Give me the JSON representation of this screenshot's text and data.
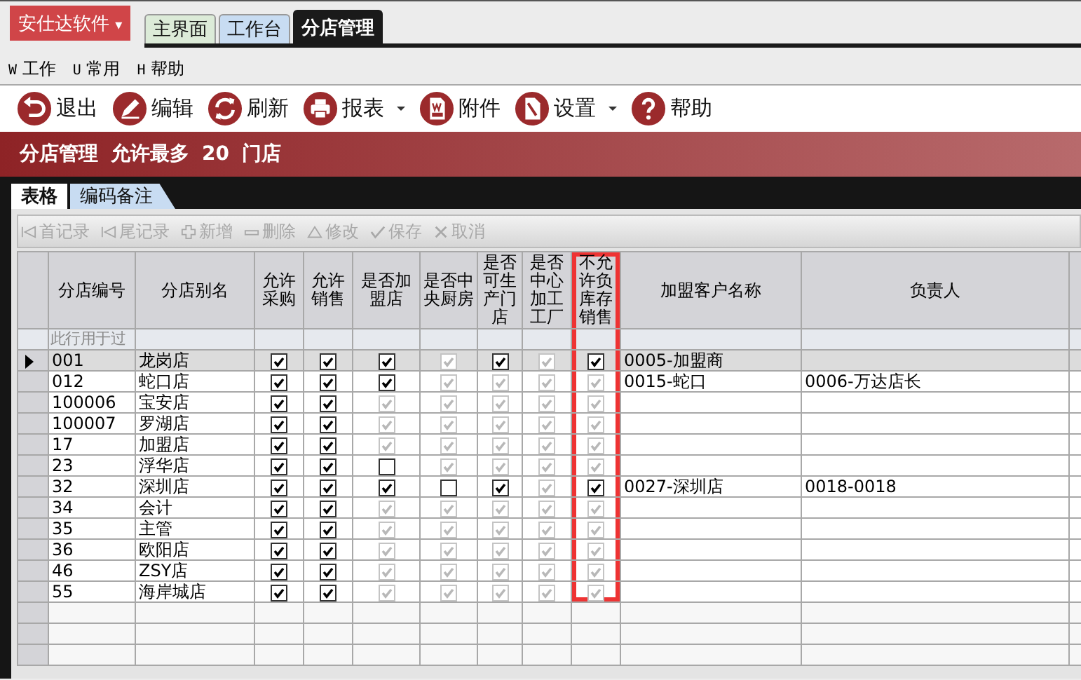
{
  "app_menu": {
    "label": "安仕达软件",
    "caret": "▾"
  },
  "window_tabs": [
    {
      "label": "主界面",
      "selected": false,
      "color": "#dcebd8"
    },
    {
      "label": "工作台",
      "selected": false,
      "color": "#c8dcf2"
    },
    {
      "label": "分店管理",
      "selected": true,
      "color": "#1a1a1a"
    }
  ],
  "menu": [
    {
      "key": "W",
      "label": "工作"
    },
    {
      "key": "U",
      "label": "常用"
    },
    {
      "key": "H",
      "label": "帮助"
    }
  ],
  "toolbar": [
    {
      "label": "退出",
      "kind": "exit",
      "dropdown": false
    },
    {
      "label": "编辑",
      "kind": "edit",
      "dropdown": false
    },
    {
      "label": "刷新",
      "kind": "refresh",
      "dropdown": false
    },
    {
      "label": "报表",
      "kind": "print",
      "dropdown": true
    },
    {
      "label": "附件",
      "kind": "attach",
      "dropdown": false
    },
    {
      "label": "设置",
      "kind": "settings",
      "dropdown": true
    },
    {
      "label": "帮助",
      "kind": "help",
      "dropdown": false
    }
  ],
  "banner": {
    "title": "分店管理",
    "text": "允许最多",
    "count": "20",
    "unit": "门店"
  },
  "sub_tabs": [
    {
      "label": "表格",
      "selected": true
    },
    {
      "label": "编码备注",
      "selected": false
    }
  ],
  "nav_bar": [
    {
      "label": "首记录",
      "kind": "first",
      "disabled": true
    },
    {
      "label": "尾记录",
      "kind": "last",
      "disabled": true
    },
    {
      "label": "新增",
      "kind": "add",
      "disabled": true
    },
    {
      "label": "删除",
      "kind": "delete",
      "disabled": true
    },
    {
      "label": "修改",
      "kind": "modify",
      "disabled": true
    },
    {
      "label": "保存",
      "kind": "save",
      "disabled": true
    },
    {
      "label": "取消",
      "kind": "cancel",
      "disabled": true
    }
  ],
  "table": {
    "columns": [
      {
        "label": "分店编号",
        "highlighted": false
      },
      {
        "label": "分店别名",
        "highlighted": false
      },
      {
        "label": "允许采购",
        "highlighted": false
      },
      {
        "label": "允许销售",
        "highlighted": false
      },
      {
        "label": "是否加盟店",
        "highlighted": false
      },
      {
        "label": "是否中央厨房",
        "highlighted": false
      },
      {
        "label": "是否可生产门店",
        "highlighted": false
      },
      {
        "label": "是否中心加工工厂",
        "highlighted": false
      },
      {
        "label": "不允许负库存销售",
        "highlighted": true
      },
      {
        "label": "加盟客户名称",
        "highlighted": false
      },
      {
        "label": "负责人",
        "highlighted": false
      }
    ],
    "filter_row_hint": "此行用于过",
    "rows": [
      {
        "selected": true,
        "code": "001",
        "name": "龙岗店",
        "checks": [
          {
            "checked": true,
            "disabled": false
          },
          {
            "checked": true,
            "disabled": false
          },
          {
            "checked": true,
            "disabled": false
          },
          {
            "checked": true,
            "disabled": true
          },
          {
            "checked": true,
            "disabled": false
          },
          {
            "checked": true,
            "disabled": true
          },
          {
            "checked": true,
            "disabled": false
          }
        ],
        "customer": "0005-加盟商",
        "manager": ""
      },
      {
        "selected": false,
        "code": "012",
        "name": "蛇口店",
        "checks": [
          {
            "checked": true,
            "disabled": false
          },
          {
            "checked": true,
            "disabled": false
          },
          {
            "checked": true,
            "disabled": false
          },
          {
            "checked": true,
            "disabled": true
          },
          {
            "checked": true,
            "disabled": true
          },
          {
            "checked": true,
            "disabled": true
          },
          {
            "checked": true,
            "disabled": true
          }
        ],
        "customer": "0015-蛇口",
        "manager": "0006-万达店长"
      },
      {
        "selected": false,
        "code": "100006",
        "name": "宝安店",
        "checks": [
          {
            "checked": true,
            "disabled": false
          },
          {
            "checked": true,
            "disabled": false
          },
          {
            "checked": true,
            "disabled": true
          },
          {
            "checked": true,
            "disabled": true
          },
          {
            "checked": true,
            "disabled": true
          },
          {
            "checked": true,
            "disabled": true
          },
          {
            "checked": true,
            "disabled": true
          }
        ],
        "customer": "",
        "manager": ""
      },
      {
        "selected": false,
        "code": "100007",
        "name": "罗湖店",
        "checks": [
          {
            "checked": true,
            "disabled": false
          },
          {
            "checked": true,
            "disabled": false
          },
          {
            "checked": true,
            "disabled": true
          },
          {
            "checked": true,
            "disabled": true
          },
          {
            "checked": true,
            "disabled": true
          },
          {
            "checked": true,
            "disabled": true
          },
          {
            "checked": true,
            "disabled": true
          }
        ],
        "customer": "",
        "manager": ""
      },
      {
        "selected": false,
        "code": "17",
        "name": "加盟店",
        "checks": [
          {
            "checked": true,
            "disabled": false
          },
          {
            "checked": true,
            "disabled": false
          },
          {
            "checked": true,
            "disabled": true
          },
          {
            "checked": true,
            "disabled": true
          },
          {
            "checked": true,
            "disabled": true
          },
          {
            "checked": true,
            "disabled": true
          },
          {
            "checked": true,
            "disabled": true
          }
        ],
        "customer": "",
        "manager": ""
      },
      {
        "selected": false,
        "code": "23",
        "name": "浮华店",
        "checks": [
          {
            "checked": true,
            "disabled": false
          },
          {
            "checked": true,
            "disabled": false
          },
          {
            "checked": false,
            "disabled": false
          },
          {
            "checked": true,
            "disabled": true
          },
          {
            "checked": true,
            "disabled": true
          },
          {
            "checked": true,
            "disabled": true
          },
          {
            "checked": true,
            "disabled": true
          }
        ],
        "customer": "",
        "manager": ""
      },
      {
        "selected": false,
        "code": "32",
        "name": "深圳店",
        "checks": [
          {
            "checked": true,
            "disabled": false
          },
          {
            "checked": true,
            "disabled": false
          },
          {
            "checked": true,
            "disabled": false
          },
          {
            "checked": false,
            "disabled": false
          },
          {
            "checked": true,
            "disabled": false
          },
          {
            "checked": true,
            "disabled": true
          },
          {
            "checked": true,
            "disabled": false
          }
        ],
        "customer": "0027-深圳店",
        "manager": "0018-0018"
      },
      {
        "selected": false,
        "code": "34",
        "name": "会计",
        "checks": [
          {
            "checked": true,
            "disabled": false
          },
          {
            "checked": true,
            "disabled": false
          },
          {
            "checked": true,
            "disabled": true
          },
          {
            "checked": true,
            "disabled": true
          },
          {
            "checked": true,
            "disabled": true
          },
          {
            "checked": true,
            "disabled": true
          },
          {
            "checked": true,
            "disabled": true
          }
        ],
        "customer": "",
        "manager": ""
      },
      {
        "selected": false,
        "code": "35",
        "name": "主管",
        "checks": [
          {
            "checked": true,
            "disabled": false
          },
          {
            "checked": true,
            "disabled": false
          },
          {
            "checked": true,
            "disabled": true
          },
          {
            "checked": true,
            "disabled": true
          },
          {
            "checked": true,
            "disabled": true
          },
          {
            "checked": true,
            "disabled": true
          },
          {
            "checked": true,
            "disabled": true
          }
        ],
        "customer": "",
        "manager": ""
      },
      {
        "selected": false,
        "code": "36",
        "name": "欧阳店",
        "checks": [
          {
            "checked": true,
            "disabled": false
          },
          {
            "checked": true,
            "disabled": false
          },
          {
            "checked": true,
            "disabled": true
          },
          {
            "checked": true,
            "disabled": true
          },
          {
            "checked": true,
            "disabled": true
          },
          {
            "checked": true,
            "disabled": true
          },
          {
            "checked": true,
            "disabled": true
          }
        ],
        "customer": "",
        "manager": ""
      },
      {
        "selected": false,
        "code": "46",
        "name": "ZSY店",
        "checks": [
          {
            "checked": true,
            "disabled": false
          },
          {
            "checked": true,
            "disabled": false
          },
          {
            "checked": true,
            "disabled": true
          },
          {
            "checked": true,
            "disabled": true
          },
          {
            "checked": true,
            "disabled": true
          },
          {
            "checked": true,
            "disabled": true
          },
          {
            "checked": true,
            "disabled": true
          }
        ],
        "customer": "",
        "manager": ""
      },
      {
        "selected": false,
        "code": "55",
        "name": "海岸城店",
        "checks": [
          {
            "checked": true,
            "disabled": false
          },
          {
            "checked": true,
            "disabled": false
          },
          {
            "checked": true,
            "disabled": true
          },
          {
            "checked": true,
            "disabled": true
          },
          {
            "checked": true,
            "disabled": true
          },
          {
            "checked": true,
            "disabled": true
          },
          {
            "checked": true,
            "disabled": true
          }
        ],
        "customer": "",
        "manager": ""
      }
    ]
  }
}
